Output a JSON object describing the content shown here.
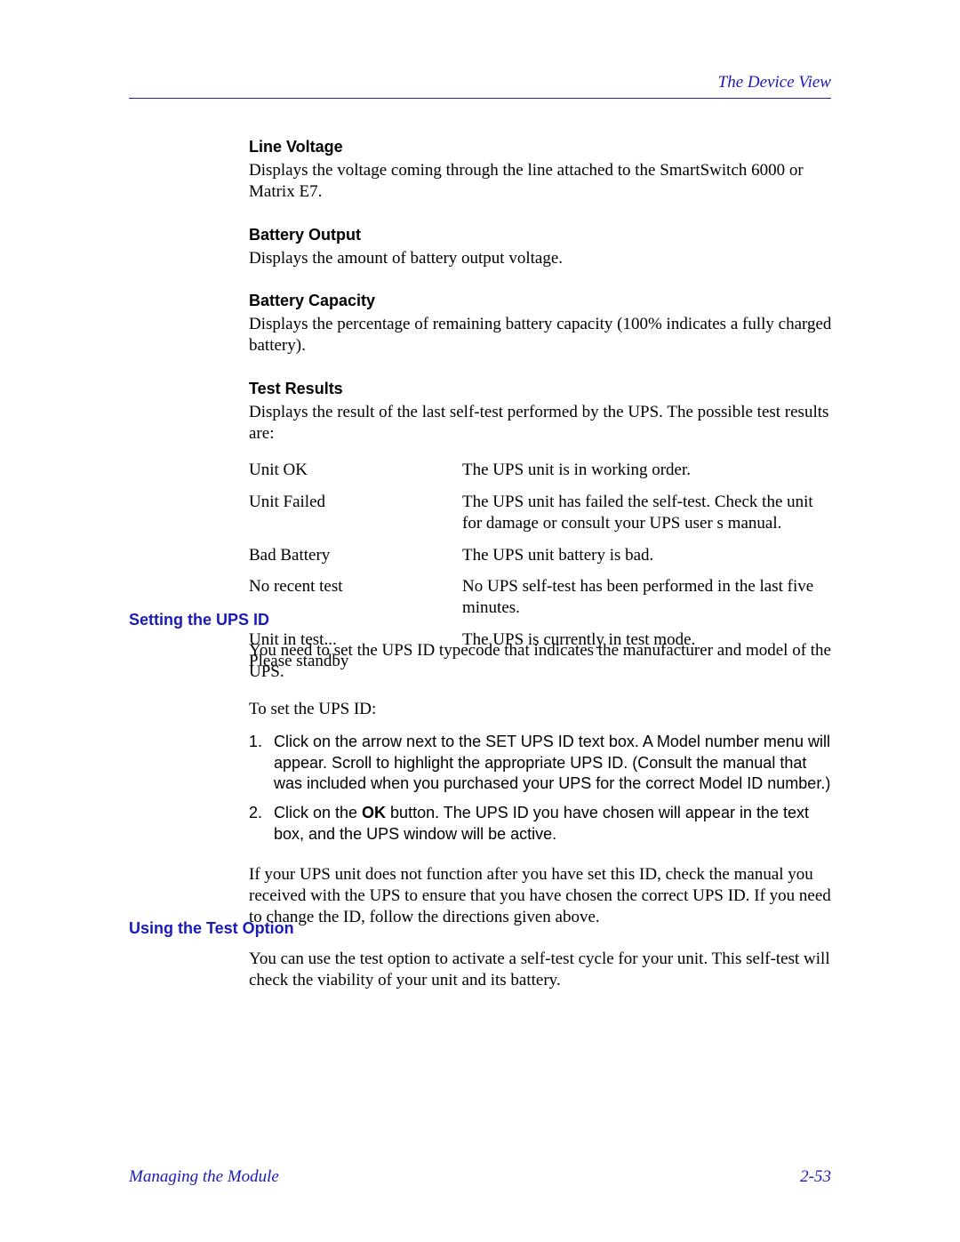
{
  "header": {
    "title": "The Device View"
  },
  "terms": {
    "lineVoltage": {
      "heading": "Line Voltage",
      "text": "Displays the voltage coming through the line attached to the SmartSwitch 6000 or Matrix E7."
    },
    "batteryOutput": {
      "heading": "Battery Output",
      "text": "Displays the amount of battery output voltage."
    },
    "batteryCapacity": {
      "heading": "Battery Capacity",
      "text": "Displays the percentage of remaining battery capacity (100% indicates a fully charged battery)."
    },
    "testResults": {
      "heading": "Test Results",
      "text": "Displays the result of the last self-test performed by the UPS. The possible test results are:"
    }
  },
  "results": [
    {
      "term": "Unit OK",
      "desc": "The UPS unit is in working order."
    },
    {
      "term": "Unit Failed",
      "desc": "The UPS unit has failed the self-test. Check the unit for damage or consult your UPS user s manual."
    },
    {
      "term": "Bad Battery",
      "desc": "The UPS unit battery is bad."
    },
    {
      "term": "No recent test",
      "desc": "No UPS self-test has been performed in the last five minutes."
    },
    {
      "term": "Unit in test...\nPlease standby",
      "desc": "The UPS is currently in test mode."
    }
  ],
  "sections": {
    "upsHeading": "Setting the UPS ID",
    "upsIntro1": "You need to set the UPS ID typecode that indicates the manufacturer and model of the UPS.",
    "upsIntro2": "To set the UPS ID:",
    "upsStep1Num": "1.",
    "upsStep1Text": "Click on the arrow next to the SET UPS ID text box. A Model number menu will appear. Scroll to highlight the appropriate UPS ID. (Consult the manual that was included when you purchased your UPS for the correct Model ID number.)",
    "upsStep2Num": "2.",
    "upsStep2Pre": "Click on the ",
    "upsStep2Bold": "OK",
    "upsStep2Post": " button. The UPS ID you have chosen will appear in the text box, and the UPS window will be active.",
    "upsOutro": "If your UPS unit does not function after you have set this ID, check the manual you received with the UPS to ensure that you have chosen the correct UPS ID. If you need to change the ID, follow the directions given above.",
    "testHeading": "Using the Test Option",
    "testText": "You can use the test option to activate a self-test cycle for your unit. This self-test will check the viability of your unit and its battery."
  },
  "footer": {
    "left": "Managing the Module",
    "right": "2-53"
  }
}
